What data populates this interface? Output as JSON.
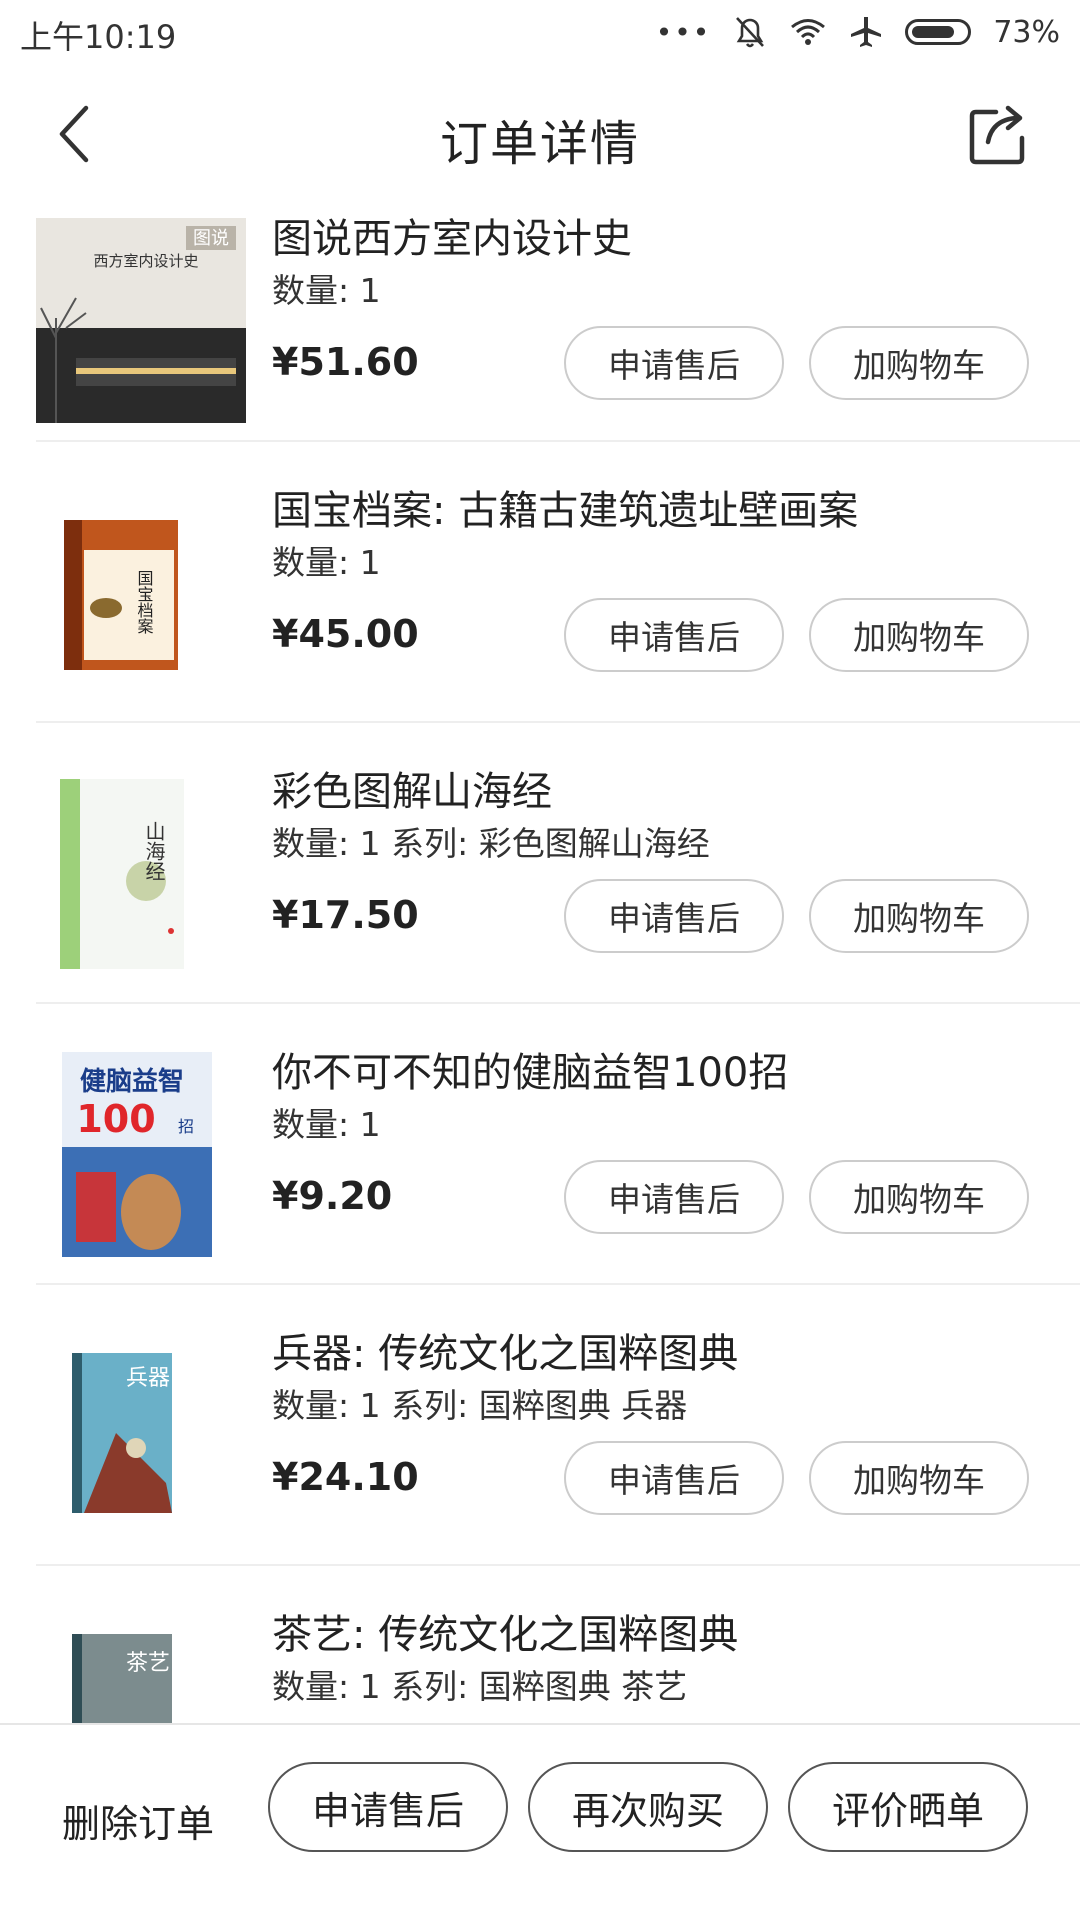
{
  "status": {
    "time": "上午10:19",
    "battery": "73%",
    "dots": "•••"
  },
  "nav": {
    "title": "订单详情"
  },
  "items": [
    {
      "title": "图说西方室内设计史",
      "meta": "数量: 1",
      "price": "¥51.60",
      "after_sale": "申请售后",
      "add_cart": "加购物车",
      "cover_title": "西方室内设计史",
      "cover_badge": "图说"
    },
    {
      "title": "国宝档案: 古籍古建筑遗址壁画案",
      "meta": "数量: 1",
      "price": "¥45.00",
      "after_sale": "申请售后",
      "add_cart": "加购物车",
      "cover_title": "国宝档案"
    },
    {
      "title": "彩色图解山海经",
      "meta": "数量: 1 系列: 彩色图解山海经",
      "price": "¥17.50",
      "after_sale": "申请售后",
      "add_cart": "加购物车",
      "cover_title": "山海经"
    },
    {
      "title": "你不可不知的健脑益智100招",
      "meta": "数量: 1",
      "price": "¥9.20",
      "after_sale": "申请售后",
      "add_cart": "加购物车",
      "cover_title": "健脑益智",
      "cover_num": "100",
      "cover_suffix": "招"
    },
    {
      "title": "兵器: 传统文化之国粹图典",
      "meta": "数量: 1 系列: 国粹图典 兵器",
      "price": "¥24.10",
      "after_sale": "申请售后",
      "add_cart": "加购物车",
      "cover_title": "兵器"
    },
    {
      "title": "茶艺: 传统文化之国粹图典",
      "meta": "数量: 1 系列: 国粹图典 茶艺",
      "price": "",
      "after_sale": "",
      "add_cart": "",
      "cover_title": "茶艺"
    }
  ],
  "bottom": {
    "delete": "删除订单",
    "after_sale": "申请售后",
    "buy_again": "再次购买",
    "review": "评价晒单"
  },
  "colors": {
    "border": "#cccccc",
    "divider": "#eeeeee",
    "text": "#222222"
  }
}
